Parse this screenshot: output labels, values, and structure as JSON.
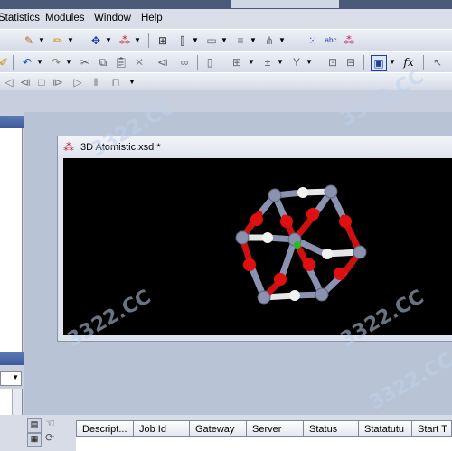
{
  "menu": [
    "Statistics",
    "Modules",
    "Window",
    "Help"
  ],
  "document": {
    "title": "3D Atomistic.xsd *"
  },
  "jobs_table": {
    "columns": [
      "Descript...",
      "Job Id",
      "Gateway",
      "Server",
      "Status",
      "Statatutu",
      "Start T"
    ]
  },
  "watermark": "3322.CC",
  "colors": {
    "viewport": "#000000",
    "oxygen": "#e01010",
    "metal": "#8a92b0",
    "hydrogen": "#f0f0f0",
    "carbon": "#20c020"
  }
}
